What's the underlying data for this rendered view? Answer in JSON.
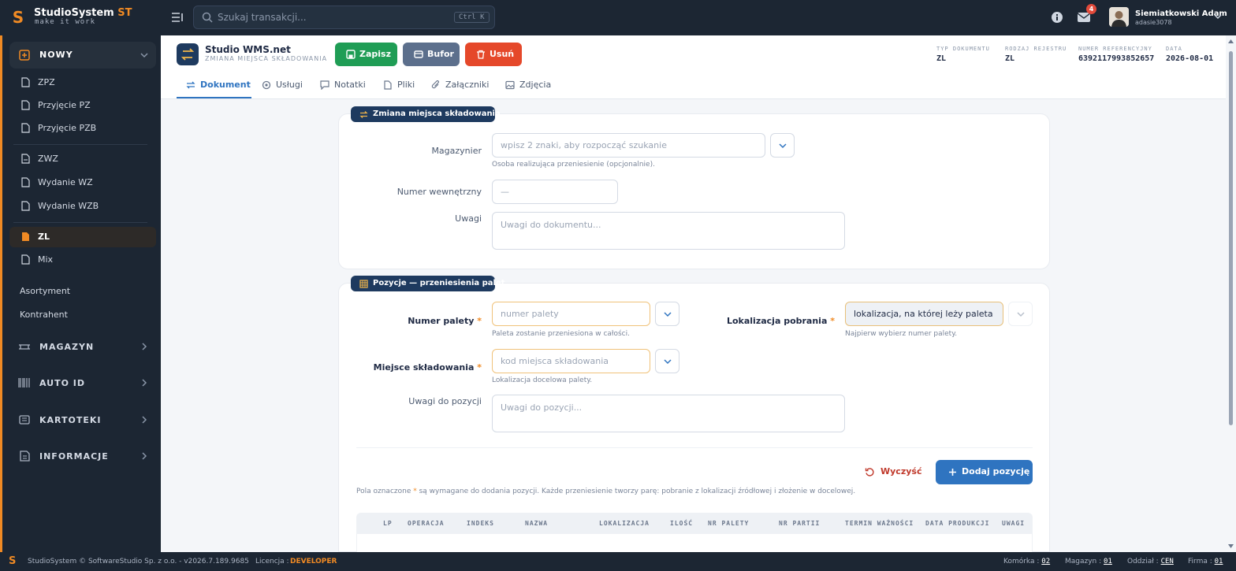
{
  "topbar": {
    "brand": "StudioSystem",
    "brand_suffix": "ST",
    "tagline": "make it work",
    "search_placeholder": "Szukaj transakcji...",
    "search_shortcut": "Ctrl K",
    "mail_count": "4",
    "user_name": "Siemiatkowski Adam",
    "user_login": "adasie3078"
  },
  "sidebar": {
    "group_new": "NOWY",
    "items_in": [
      "ZPZ",
      "Przyjęcie PZ",
      "Przyjęcie PZB"
    ],
    "items_out": [
      "ZWZ",
      "Wydanie WZ",
      "Wydanie WZB"
    ],
    "items_other": [
      "ZL",
      "Mix"
    ],
    "active_item": "ZL",
    "plain": [
      "Asortyment",
      "Kontrahent"
    ],
    "categories": [
      "MAGAZYN",
      "AUTO ID",
      "KARTOTEKI",
      "INFORMACJE"
    ]
  },
  "header": {
    "app_name": "Studio WMS.net",
    "app_sub": "ZMIANA MIEJSCA SKŁADOWANIA",
    "save": "Zapisz",
    "buffer": "Bufor",
    "delete": "Usuń",
    "meta": [
      {
        "key": "TYP DOKUMENTU",
        "value": "ZL"
      },
      {
        "key": "RODZAJ REJESTRU",
        "value": "ZL"
      },
      {
        "key": "NUMER REFERENCYJNY",
        "value": "6392117993852657"
      },
      {
        "key": "DATA",
        "value": "2026-08-01"
      }
    ],
    "tabs": [
      "Dokument",
      "Usługi",
      "Notatki",
      "Pliki",
      "Załączniki",
      "Zdjęcia"
    ],
    "active_tab": "Dokument"
  },
  "section1": {
    "badge": "Zmiana miejsca składowania",
    "warehouseman_label": "Magazynier",
    "warehouseman_placeholder": "wpisz 2 znaki, aby rozpocząć szukanie",
    "warehouseman_hint": "Osoba realizująca przeniesienie (opcjonalnie).",
    "internal_no_label": "Numer wewnętrzny",
    "internal_no_value": "—",
    "notes_label": "Uwagi",
    "notes_placeholder": "Uwagi do dokumentu..."
  },
  "section2": {
    "badge": "Pozycje — przeniesienia palet",
    "pallet_label": "Numer palety",
    "pallet_placeholder": "numer palety",
    "pallet_hint": "Paleta zostanie przeniesiona w całości.",
    "pickup_label": "Lokalizacja pobrania",
    "pickup_value": "lokalizacja, na której leży paleta",
    "pickup_hint": "Najpierw wybierz numer palety.",
    "storage_label": "Miejsce składowania",
    "storage_placeholder": "kod miejsca składowania",
    "storage_hint": "Lokalizacja docelowa palety.",
    "pos_notes_label": "Uwagi do pozycji",
    "pos_notes_placeholder": "Uwagi do pozycji...",
    "required_star": "*",
    "clear": "Wyczyść",
    "add": "Dodaj pozycję",
    "note_before": "Pola oznaczone",
    "note_after": "są wymagane do dodania pozycji. Każde przeniesienie tworzy parę: pobranie z lokalizacji źródłowej i złożenie w docelowej.",
    "columns": [
      "LP",
      "OPERACJA",
      "INDEKS",
      "NAZWA",
      "LOKALIZACJA",
      "ILOŚĆ",
      "NR PALETY",
      "NR PARTII",
      "TERMIN WAŻNOŚCI",
      "DATA PRODUKCJI",
      "UWAGI"
    ]
  },
  "footer": {
    "copyright": "StudioSystem © SoftwareStudio Sp. z o.o. - v2026.7.189.9685",
    "license_label": "Licencja :",
    "license": "DEVELOPER",
    "cell_label": "Komórka :",
    "cell": "02",
    "warehouse_label": "Magazyn :",
    "warehouse": "01",
    "branch_label": "Oddział :",
    "branch": "CEN",
    "company_label": "Firma :",
    "company": "01"
  },
  "colors": {
    "accent": "#f08a24",
    "primary": "#2f74c0",
    "save": "#1f9d55",
    "buffer": "#5c6f8c",
    "delete": "#e5482a",
    "sidebar": "#1c2633"
  }
}
